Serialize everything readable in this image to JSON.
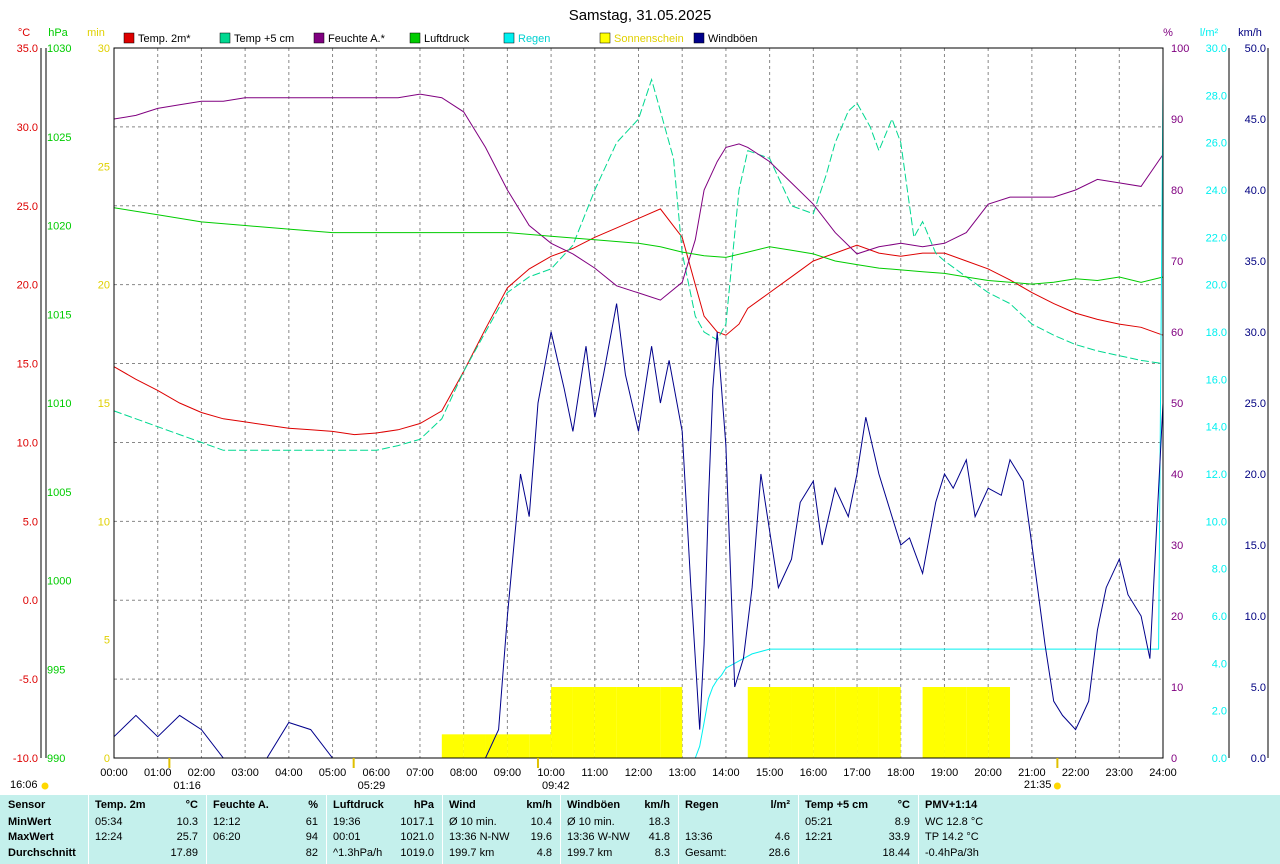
{
  "title": "Samstag, 31.05.2025",
  "colors": {
    "temp2m": "#dd0000",
    "temp5cm": "#00d890",
    "humidity": "#800080",
    "pressure": "#00cc00",
    "rain": "#00f0f0",
    "sunshine": "#ffff00",
    "gusts": "#00008b",
    "grid": "#888888",
    "stats_bg": "#c4f0ec"
  },
  "legend": [
    {
      "key": "temp2m",
      "label": "Temp. 2m*"
    },
    {
      "key": "temp5cm",
      "label": "Temp +5 cm"
    },
    {
      "key": "humidity",
      "label": "Feuchte A.*"
    },
    {
      "key": "pressure",
      "label": "Luftdruck"
    },
    {
      "key": "rain",
      "label": "Regen"
    },
    {
      "key": "sunshine",
      "label": "Sonnenschein"
    },
    {
      "key": "gusts",
      "label": "Windböen"
    }
  ],
  "axis_units": {
    "temp": "°C",
    "pressure": "hPa",
    "sunshine": "min",
    "humidity": "%",
    "rain": "l/m²",
    "wind": "km/h"
  },
  "time_ticks": [
    "00:00",
    "01:00",
    "02:00",
    "03:00",
    "04:00",
    "05:00",
    "06:00",
    "07:00",
    "08:00",
    "09:00",
    "10:00",
    "11:00",
    "12:00",
    "13:00",
    "14:00",
    "15:00",
    "16:00",
    "17:00",
    "18:00",
    "19:00",
    "20:00",
    "21:00",
    "22:00",
    "23:00",
    "24:00"
  ],
  "event_markers": [
    {
      "time": "01:16",
      "label": "01:16"
    },
    {
      "time": "05:29",
      "label": "05:29"
    },
    {
      "time": "09:42",
      "label": "09:42"
    }
  ],
  "sunrise": "05:29",
  "sunset": "21:35",
  "ms_left": "16:06",
  "ms_right": "21:35",
  "chart_data": {
    "type": "line",
    "title": "Samstag, 31.05.2025",
    "x_unit": "hours",
    "xlim": [
      0,
      24
    ],
    "axes": {
      "temp": {
        "range": [
          -10,
          35
        ],
        "ticks": [
          "35.0",
          "30.0",
          "25.0",
          "20.0",
          "15.0",
          "10.0",
          "5.0",
          "0.0",
          "-5.0",
          "-10.0"
        ]
      },
      "pressure": {
        "range": [
          990,
          1030
        ],
        "ticks": [
          "1030",
          "1025",
          "1020",
          "1015",
          "1010",
          "1005",
          "1000",
          "995",
          "990"
        ]
      },
      "sunshine": {
        "range": [
          0,
          30
        ],
        "ticks": [
          "30",
          "25",
          "20",
          "15",
          "10",
          "5",
          "0"
        ]
      },
      "humidity": {
        "range": [
          0,
          100
        ],
        "ticks": [
          "100",
          "90",
          "80",
          "70",
          "60",
          "50",
          "40",
          "30",
          "20",
          "10",
          "0"
        ]
      },
      "rain": {
        "range": [
          0,
          30
        ],
        "ticks": [
          "30.0",
          "28.0",
          "26.0",
          "24.0",
          "22.0",
          "20.0",
          "18.0",
          "16.0",
          "14.0",
          "12.0",
          "10.0",
          "8.0",
          "6.0",
          "4.0",
          "2.0",
          "0.0"
        ]
      },
      "wind": {
        "range": [
          0,
          50
        ],
        "ticks": [
          "50.0",
          "45.0",
          "40.0",
          "35.0",
          "30.0",
          "25.0",
          "20.0",
          "15.0",
          "10.0",
          "5.0",
          "0.0"
        ]
      }
    },
    "grid": true,
    "legend_position": "top",
    "series": [
      {
        "name": "Temp. 2m*",
        "axis": "temp",
        "style": "line",
        "x": [
          0,
          0.5,
          1,
          1.5,
          2,
          2.5,
          3,
          3.5,
          4,
          4.5,
          5,
          5.5,
          6,
          6.5,
          7,
          7.5,
          8,
          8.5,
          9,
          9.5,
          10,
          10.5,
          11,
          11.5,
          12,
          12.5,
          13,
          13.3,
          13.5,
          13.8,
          14,
          14.3,
          14.5,
          15,
          15.5,
          16,
          16.5,
          17,
          17.5,
          18,
          18.5,
          19,
          19.5,
          20,
          20.5,
          21,
          21.5,
          22,
          22.5,
          23,
          23.5,
          24
        ],
        "y": [
          14.8,
          14.0,
          13.3,
          12.5,
          11.9,
          11.5,
          11.3,
          11.1,
          10.9,
          10.8,
          10.7,
          10.5,
          10.6,
          10.8,
          11.2,
          12.0,
          14.5,
          17.2,
          19.8,
          21.0,
          21.8,
          22.3,
          23.0,
          23.6,
          24.2,
          24.8,
          23.0,
          20.0,
          18.0,
          17.0,
          16.8,
          17.5,
          18.5,
          19.5,
          20.5,
          21.5,
          22.0,
          22.5,
          22.0,
          21.8,
          22.0,
          22.0,
          21.5,
          21.0,
          20.3,
          19.5,
          18.8,
          18.2,
          17.8,
          17.5,
          17.3,
          16.8
        ]
      },
      {
        "name": "Temp +5 cm",
        "axis": "temp",
        "style": "dashed",
        "x": [
          0,
          0.5,
          1,
          1.5,
          2,
          2.5,
          3,
          3.5,
          4,
          4.5,
          5,
          5.5,
          6,
          6.5,
          7,
          7.5,
          8,
          8.5,
          9,
          9.5,
          10,
          10.5,
          11,
          11.5,
          12,
          12.3,
          12.5,
          12.8,
          13,
          13.3,
          13.5,
          13.8,
          14,
          14.3,
          14.5,
          15,
          15.5,
          16,
          16.3,
          16.5,
          16.8,
          17,
          17.3,
          17.5,
          17.8,
          18,
          18.3,
          18.5,
          18.8,
          19,
          19.5,
          20,
          20.5,
          21,
          21.5,
          22,
          22.5,
          23,
          23.5,
          24
        ],
        "y": [
          12.0,
          11.5,
          11.0,
          10.5,
          10.0,
          9.5,
          9.5,
          9.5,
          9.5,
          9.5,
          9.5,
          9.5,
          9.5,
          9.8,
          10.2,
          11.5,
          14.5,
          17.0,
          19.5,
          20.5,
          21.0,
          22.5,
          26.0,
          29.0,
          30.5,
          33.0,
          31.0,
          28.0,
          22.0,
          18.0,
          17.0,
          16.5,
          17.5,
          26.0,
          28.5,
          28.0,
          25.0,
          24.5,
          27.0,
          29.0,
          31.0,
          31.5,
          30.0,
          28.5,
          30.5,
          29.0,
          23.0,
          24.0,
          22.0,
          21.5,
          20.5,
          19.5,
          18.8,
          17.5,
          16.8,
          16.2,
          15.8,
          15.5,
          15.2,
          15.0
        ]
      },
      {
        "name": "Feuchte A.*",
        "axis": "humidity",
        "style": "line",
        "x": [
          0,
          0.5,
          1,
          1.5,
          2,
          2.5,
          3,
          3.5,
          4,
          4.5,
          5,
          5.5,
          6,
          6.5,
          7,
          7.5,
          8,
          8.5,
          9,
          9.5,
          10,
          10.5,
          11,
          11.5,
          12,
          12.5,
          13,
          13.3,
          13.5,
          13.8,
          14,
          14.3,
          14.5,
          15,
          15.5,
          16,
          16.5,
          17,
          17.5,
          18,
          18.5,
          19,
          19.5,
          20,
          20.5,
          21,
          21.5,
          22,
          22.5,
          23,
          23.5,
          24
        ],
        "y": [
          90.0,
          90.5,
          91.5,
          92.0,
          92.5,
          92.5,
          93.0,
          93.0,
          93.0,
          93.0,
          93.0,
          93.0,
          93.0,
          93.0,
          93.5,
          93.0,
          91.0,
          86.0,
          80.0,
          75.0,
          72.5,
          71.0,
          69.0,
          66.5,
          65.5,
          64.5,
          67.0,
          73.0,
          80.0,
          84.0,
          86.0,
          86.5,
          86.0,
          84.0,
          81.0,
          78.0,
          74.0,
          71.0,
          72.0,
          72.5,
          72.0,
          72.5,
          74.0,
          78.0,
          79.0,
          79.0,
          79.0,
          80.0,
          81.5,
          81.0,
          80.5,
          85.0
        ]
      },
      {
        "name": "Luftdruck",
        "axis": "pressure",
        "style": "line",
        "x": [
          0,
          1,
          2,
          3,
          4,
          5,
          6,
          7,
          8,
          9,
          10,
          11,
          12,
          12.5,
          13,
          13.5,
          14,
          14.5,
          15,
          15.5,
          16,
          16.5,
          17,
          17.5,
          18,
          18.5,
          19,
          19.5,
          20,
          20.5,
          21,
          21.5,
          22,
          22.5,
          23,
          23.5,
          24
        ],
        "y": [
          1021.0,
          1020.6,
          1020.2,
          1020.0,
          1019.8,
          1019.6,
          1019.6,
          1019.6,
          1019.6,
          1019.6,
          1019.4,
          1019.2,
          1019.0,
          1018.8,
          1018.5,
          1018.3,
          1018.2,
          1018.5,
          1018.8,
          1018.6,
          1018.4,
          1018.0,
          1017.8,
          1017.6,
          1017.5,
          1017.4,
          1017.3,
          1017.1,
          1016.9,
          1016.8,
          1016.7,
          1016.8,
          1017.0,
          1016.9,
          1017.1,
          1016.8,
          1017.1
        ]
      },
      {
        "name": "Regen",
        "axis": "rain",
        "style": "line",
        "x": [
          0,
          13.0,
          13.2,
          13.3,
          13.4,
          13.5,
          13.6,
          13.7,
          13.8,
          13.9,
          14.0,
          14.2,
          14.4,
          14.6,
          14.8,
          15.0,
          16.0,
          18.0,
          20.0,
          22.0,
          23.9,
          24.0
        ],
        "y": [
          0,
          0,
          0,
          0,
          0.5,
          1.5,
          2.5,
          3.0,
          3.3,
          3.5,
          3.8,
          4.0,
          4.2,
          4.4,
          4.5,
          4.6,
          4.6,
          4.6,
          4.6,
          4.6,
          4.6,
          28.6
        ]
      },
      {
        "name": "Windböen",
        "axis": "wind",
        "style": "line",
        "x": [
          0,
          0.5,
          1,
          1.5,
          2,
          2.5,
          3,
          3.5,
          4,
          4.5,
          5,
          5.5,
          6,
          6.5,
          7,
          7.5,
          8,
          8.5,
          8.8,
          9,
          9.3,
          9.5,
          9.7,
          10,
          10.3,
          10.5,
          10.8,
          11,
          11.2,
          11.5,
          11.7,
          12,
          12.3,
          12.5,
          12.7,
          13,
          13.2,
          13.4,
          13.5,
          13.6,
          13.7,
          13.8,
          14,
          14.2,
          14.4,
          14.6,
          14.8,
          15,
          15.2,
          15.5,
          15.7,
          16,
          16.2,
          16.5,
          16.8,
          17,
          17.2,
          17.5,
          17.8,
          18,
          18.2,
          18.5,
          18.8,
          19,
          19.2,
          19.5,
          19.7,
          20,
          20.3,
          20.5,
          20.8,
          21,
          21.3,
          21.5,
          21.7,
          22,
          22.3,
          22.5,
          22.7,
          23,
          23.2,
          23.5,
          23.7,
          24
        ],
        "y": [
          1.5,
          3.0,
          1.5,
          3.0,
          2.0,
          0,
          0,
          0,
          2.5,
          2.0,
          0,
          0,
          0,
          0,
          0,
          0,
          0,
          0,
          2.0,
          10.0,
          20.0,
          17.0,
          25.0,
          30.0,
          26.0,
          23.0,
          29.0,
          24.0,
          27.0,
          32.0,
          27.0,
          23.0,
          29.0,
          25.0,
          28.0,
          23.0,
          12.0,
          2.0,
          8.0,
          18.0,
          26.0,
          30.0,
          22.0,
          5.0,
          7.0,
          12.0,
          20.0,
          16.0,
          12.0,
          14.0,
          18.0,
          19.5,
          15.0,
          19.0,
          17.0,
          20.0,
          24.0,
          20.0,
          17.0,
          15.0,
          15.5,
          13.0,
          18.0,
          20.0,
          19.0,
          21.0,
          17.0,
          19.0,
          18.5,
          21.0,
          19.5,
          15.0,
          8.0,
          4.0,
          3.0,
          2.0,
          4.0,
          9.0,
          12.0,
          14.0,
          11.5,
          10.0,
          7.0,
          25.0
        ]
      },
      {
        "name": "Sonnenschein",
        "axis": "sunshine",
        "style": "bars",
        "x": [
          7.5,
          8,
          8.5,
          9,
          9.5,
          10,
          10.5,
          11,
          11.5,
          12,
          12.5,
          14.5,
          15,
          15.5,
          16,
          16.5,
          17,
          17.5,
          18.5,
          19,
          19.5,
          20
        ],
        "y": [
          1,
          1,
          1,
          1,
          1,
          3,
          3,
          3,
          3,
          3,
          3,
          3,
          3,
          3,
          3,
          3,
          3,
          3,
          3,
          3,
          3,
          3
        ]
      }
    ]
  },
  "stats": {
    "header_sensor": "Sensor",
    "row_labels": [
      "MinWert",
      "MaxWert",
      "Durchschnitt"
    ],
    "columns": [
      {
        "title": "Temp. 2m",
        "unit": "°C",
        "rows": [
          [
            "05:34",
            "10.3"
          ],
          [
            "12:24",
            "25.7"
          ],
          [
            "",
            "17.89"
          ]
        ]
      },
      {
        "title": "Feuchte A.",
        "unit": "%",
        "rows": [
          [
            "12:12",
            "61"
          ],
          [
            "06:20",
            "94"
          ],
          [
            "",
            "82"
          ]
        ]
      },
      {
        "title": "Luftdruck",
        "unit": "hPa",
        "rows": [
          [
            "19:36",
            "1017.1"
          ],
          [
            "00:01",
            "1021.0"
          ],
          [
            "^1.3hPa/h",
            "1019.0"
          ]
        ]
      },
      {
        "title": "Wind",
        "unit": "km/h",
        "rows": [
          [
            "Ø 10 min.",
            "10.4"
          ],
          [
            "13:36   N-NW",
            "19.6"
          ],
          [
            "199.7 km",
            "4.8"
          ]
        ]
      },
      {
        "title": "Windböen",
        "unit": "km/h",
        "rows": [
          [
            "Ø 10 min.",
            "18.3"
          ],
          [
            "13:36   W-NW",
            "41.8"
          ],
          [
            "199.7 km",
            "8.3"
          ]
        ]
      },
      {
        "title": "Regen",
        "unit": "l/m²",
        "rows": [
          [
            "",
            ""
          ],
          [
            "13:36",
            "4.6"
          ],
          [
            "Gesamt:",
            "28.6"
          ]
        ]
      },
      {
        "title": "Temp +5 cm",
        "unit": "°C",
        "rows": [
          [
            "05:21",
            "8.9"
          ],
          [
            "12:21",
            "33.9"
          ],
          [
            "",
            "18.44"
          ]
        ]
      },
      {
        "title": "PMV+1:14",
        "unit": "",
        "rows": [
          [
            "WC 12.8 °C",
            ""
          ],
          [
            "TP 14.2 °C",
            ""
          ],
          [
            "-0.4hPa/3h",
            ""
          ]
        ]
      }
    ]
  }
}
